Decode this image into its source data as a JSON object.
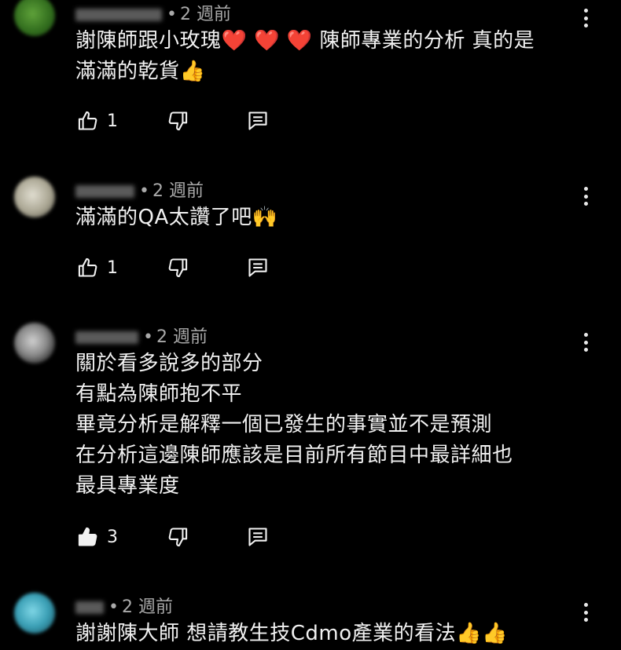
{
  "comments": [
    {
      "time": "2 週前",
      "lines": [
        "謝陳師跟小玫瑰❤️ ❤️ ❤️ 陳師專業的分析 真的是",
        "滿滿的乾貨👍"
      ],
      "like_count": "1",
      "like_filled": false
    },
    {
      "time": "2 週前",
      "lines": [
        "滿滿的QA太讚了吧🙌"
      ],
      "like_count": "1",
      "like_filled": false
    },
    {
      "time": "2 週前",
      "lines": [
        "關於看多說多的部分",
        "有點為陳師抱不平",
        "畢竟分析是解釋一個已發生的事實並不是預測",
        "在分析這邊陳師應該是目前所有節目中最詳細也",
        "最具專業度"
      ],
      "like_count": "3",
      "like_filled": true
    },
    {
      "time": "2 週前",
      "lines": [
        "謝謝陳大師 想請教生技Cdmo產業的看法👍👍"
      ],
      "like_count": "",
      "like_filled": false
    }
  ],
  "icons": {
    "like": "thumbs-up-icon",
    "dislike": "thumbs-down-icon",
    "reply": "reply-icon",
    "menu": "more-vertical-icon"
  },
  "colors": {
    "background": "#000000",
    "text": "#f1f1f1",
    "meta": "#aaaaaa"
  }
}
